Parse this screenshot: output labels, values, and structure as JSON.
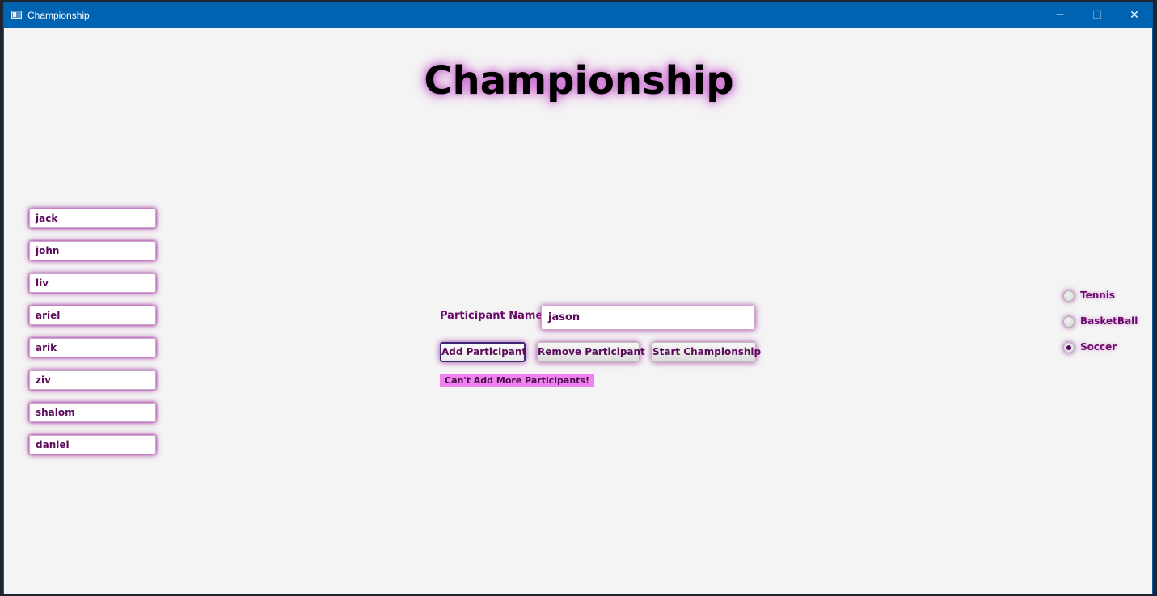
{
  "window": {
    "title": "Championship",
    "controls": {
      "minimize": "─",
      "maximize": "☐",
      "close": "✕"
    }
  },
  "heading": "Championship",
  "participants": [
    "jack",
    "john",
    "liv",
    "ariel",
    "arik",
    "ziv",
    "shalom",
    "daniel"
  ],
  "form": {
    "label": "Participant Name:",
    "name_value": "jason",
    "add_label": "Add Participant",
    "remove_label": "Remove Participant",
    "start_label": "Start Championship",
    "error_message": "Can't Add More Participants!"
  },
  "sports": [
    {
      "label": "Tennis",
      "selected": false
    },
    {
      "label": "BasketBall",
      "selected": false
    },
    {
      "label": "Soccer",
      "selected": true
    }
  ],
  "colors": {
    "accent": "#6a0a6a",
    "glow": "#a640a6",
    "error_bg": "#ee82ee",
    "titlebar": "#0063b1"
  }
}
